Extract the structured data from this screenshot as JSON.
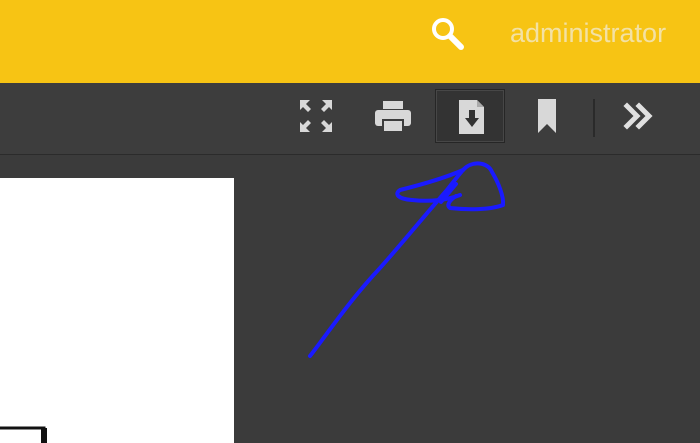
{
  "header": {
    "user_name": "administrator",
    "search_icon": "search-icon",
    "background_color": "#f7c414"
  },
  "toolbar": {
    "buttons": [
      {
        "name": "fullscreen",
        "icon": "expand-icon"
      },
      {
        "name": "print",
        "icon": "printer-icon"
      },
      {
        "name": "download",
        "icon": "download-icon",
        "active": true
      },
      {
        "name": "bookmark",
        "icon": "bookmark-icon"
      },
      {
        "name": "more",
        "icon": "double-chevron-right-icon"
      }
    ]
  },
  "annotation": {
    "color": "#1a1aff",
    "icon": "hand-drawn-arrow"
  }
}
